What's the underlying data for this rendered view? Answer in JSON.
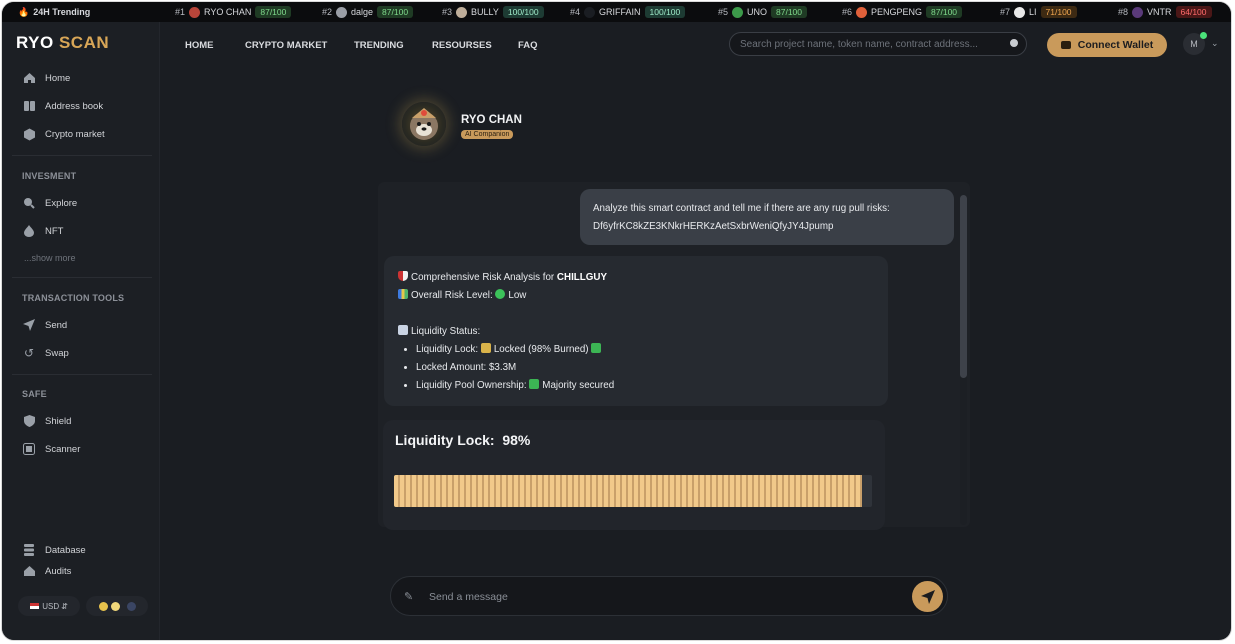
{
  "ticker": {
    "title": "24H Trending",
    "items": [
      {
        "rank": "#1",
        "name": "RYO CHAN",
        "score": "87/100",
        "color": "#7fd98b"
      },
      {
        "rank": "#2",
        "name": "dalge",
        "score": "87/100",
        "color": "#7fd98b"
      },
      {
        "rank": "#3",
        "name": "BULLY",
        "score": "100/100",
        "color": "#9ee9c8"
      },
      {
        "rank": "#4",
        "name": "GRIFFAIN",
        "score": "100/100",
        "color": "#9ee9c8"
      },
      {
        "rank": "#5",
        "name": "UNO",
        "score": "87/100",
        "color": "#7fd98b"
      },
      {
        "rank": "#6",
        "name": "PENGPENG",
        "score": "87/100",
        "color": "#7fd98b"
      },
      {
        "rank": "#7",
        "name": "LI",
        "score": "71/100",
        "color": "#f0a650"
      },
      {
        "rank": "#8",
        "name": "VNTR",
        "score": "64/100",
        "color": "#ff6b6b"
      }
    ]
  },
  "brand": {
    "part1": "RYO",
    "part2": "SCAN",
    "accent": "#d8a657"
  },
  "sidebar": {
    "main": [
      {
        "label": "Home",
        "icon": "home-icon"
      },
      {
        "label": "Address book",
        "icon": "book-icon"
      },
      {
        "label": "Crypto market",
        "icon": "market-icon"
      }
    ],
    "investment": {
      "heading": "INVESMENT",
      "items": [
        {
          "label": "Explore",
          "icon": "search-icon"
        },
        {
          "label": "NFT",
          "icon": "nft-icon"
        }
      ],
      "show_more": "...show more"
    },
    "transaction_tools": {
      "heading": "TRANSACTION TOOLS",
      "items": [
        {
          "label": "Send",
          "icon": "send-icon"
        },
        {
          "label": "Swap",
          "icon": "swap-icon"
        }
      ]
    },
    "safe": {
      "heading": "SAFE",
      "items": [
        {
          "label": "Shield",
          "icon": "shield-icon"
        },
        {
          "label": "Scanner",
          "icon": "scanner-icon"
        }
      ]
    },
    "bottom": [
      {
        "label": "Database",
        "icon": "database-icon"
      },
      {
        "label": "Audits",
        "icon": "audits-icon"
      }
    ],
    "currency": "USD"
  },
  "topnav": {
    "links": [
      "HOME",
      "CRYPTO MARKET",
      "TRENDING",
      "RESOURSES",
      "FAQ"
    ],
    "search_placeholder": "Search project name, token name, contract address...",
    "connect_label": "Connect Wallet",
    "avatar_initial": "M"
  },
  "bot": {
    "name": "RYO CHAN",
    "badge": "AI Companion"
  },
  "chat": {
    "user_line1": "Analyze this smart contract and tell me if there are any rug pull risks:",
    "user_line2": "Df6yfrKC8kZE3KNkrHERKzAetSxbrWeniQfyJY4Jpump",
    "bot": {
      "analysis_prefix": "Comprehensive Risk Analysis for ",
      "token": "CHILLGUY",
      "risk_label": "Overall Risk Level: ",
      "risk_value": "Low",
      "liquidity_heading": "Liquidity Status:",
      "bullets": [
        {
          "label": "Liquidity Lock: ",
          "value": "Locked (98% Burned)"
        },
        {
          "label": "Locked Amount: ",
          "value": "$3.3M"
        },
        {
          "label": "Liquidity Pool Ownership: ",
          "value": "Majority secured"
        }
      ]
    },
    "lock_card": {
      "title": "Liquidity Lock:",
      "value_text": "98%",
      "fraction": 0.98
    }
  },
  "composer": {
    "placeholder": "Send a message"
  }
}
